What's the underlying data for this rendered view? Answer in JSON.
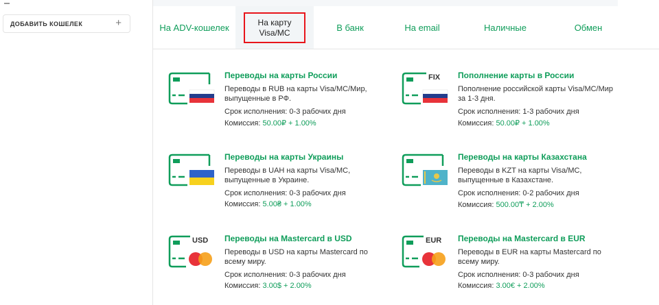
{
  "sidebar": {
    "add_wallet_label": "ДОБАВИТЬ КОШЕЛЕК",
    "add_wallet_icon": "plus-icon"
  },
  "tabs": [
    {
      "label": "На ADV-кошелек"
    },
    {
      "label": "На карту Visa/MC",
      "active": true
    },
    {
      "label": "В банк"
    },
    {
      "label": "На email"
    },
    {
      "label": "Наличные"
    },
    {
      "label": "Обмен"
    }
  ],
  "offers": [
    {
      "title": "Переводы на карты России",
      "desc": "Переводы в RUB на карты Visa/MC/Мир, выпущенные в РФ.",
      "term": "Срок исполнения: 0-3 рабочих дня",
      "fee_label": "Комиссия: ",
      "fee_value": "50.00₽ + 1.00%",
      "icon": "card-russia-flag-icon"
    },
    {
      "title": "Пополнение карты в России",
      "desc": "Пополнение российской карты Visa/MC/Мир за 1-3 дня.",
      "term": "Срок исполнения: 1-3 рабочих дня",
      "fee_label": "Комиссия: ",
      "fee_value": "50.00₽ + 1.00%",
      "icon": "card-russia-flag-fix-icon",
      "badge": "FIX"
    },
    {
      "title": "Переводы на карты Украины",
      "desc": "Переводы в UAH на карты Visa/MC, выпущенные в Украине.",
      "term": "Срок исполнения: 0-3 рабочих дня",
      "fee_label": "Комиссия: ",
      "fee_value": "5.00₴ + 1.00%",
      "icon": "card-ukraine-flag-icon"
    },
    {
      "title": "Переводы на карты Казахстана",
      "desc": "Переводы в KZT на карты Visa/MC, выпущенные в Казахстане.",
      "term": "Срок исполнения: 0-2 рабочих дня",
      "fee_label": "Комиссия: ",
      "fee_value": "500.00₸ + 2.00%",
      "icon": "card-kazakhstan-flag-icon"
    },
    {
      "title": "Переводы на Mastercard в USD",
      "desc": "Переводы в USD на карты Mastercard по всему миру.",
      "term": "Срок исполнения: 0-3 рабочих дня",
      "fee_label": "Комиссия: ",
      "fee_value": "3.00$ + 2.00%",
      "icon": "card-mastercard-usd-icon",
      "badge": "USD"
    },
    {
      "title": "Переводы на Mastercard в EUR",
      "desc": "Переводы в EUR на карты Mastercard по всему миру.",
      "term": "Срок исполнения: 0-3 рабочих дня",
      "fee_label": "Комиссия: ",
      "fee_value": "3.00€ + 2.00%",
      "icon": "card-mastercard-eur-icon",
      "badge": "EUR"
    }
  ],
  "colors": {
    "accent_green": "#0f9d5a",
    "highlight_red": "#e8141a",
    "text": "#333333"
  }
}
